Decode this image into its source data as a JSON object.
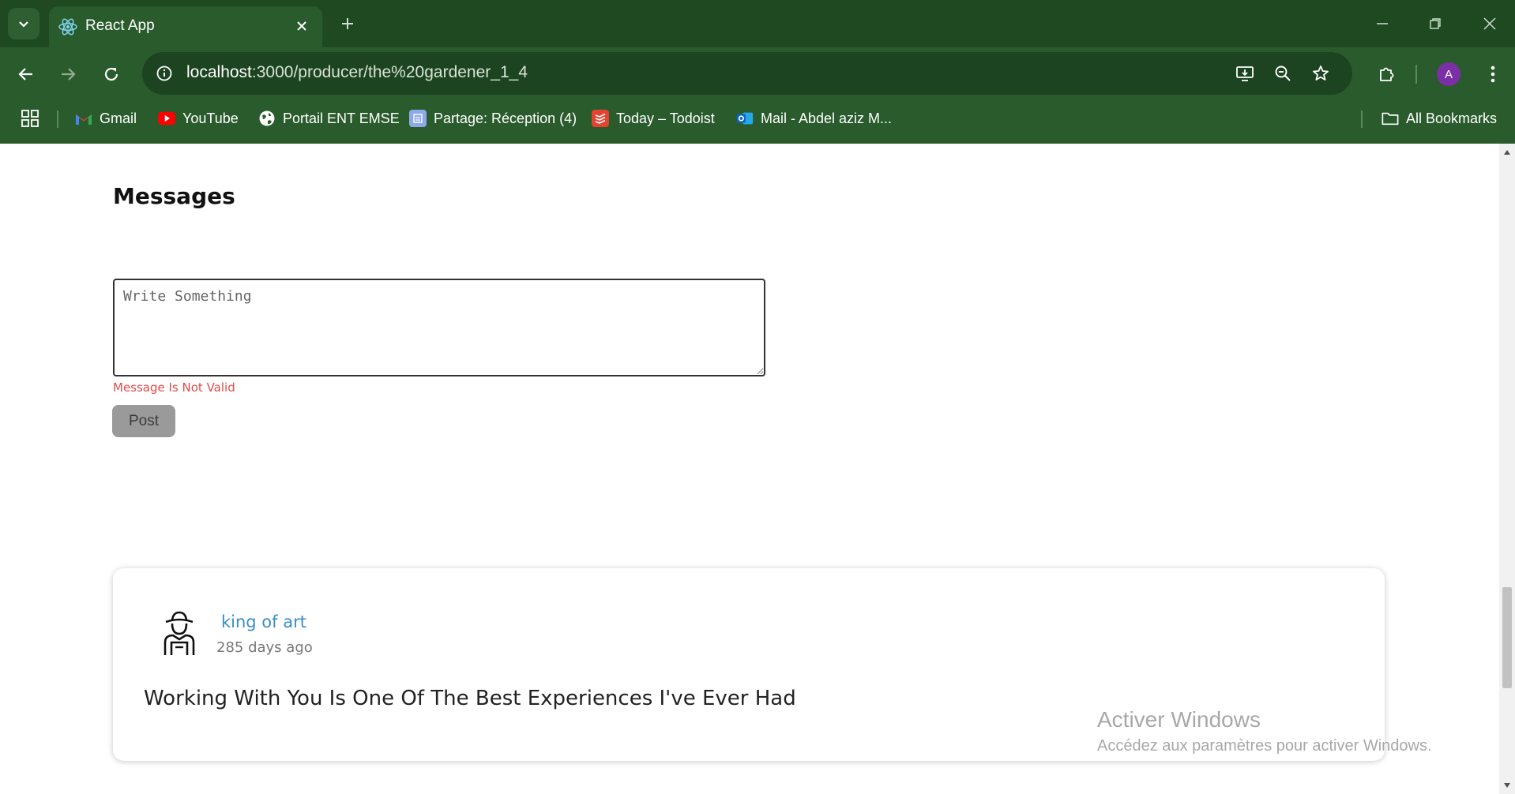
{
  "browser": {
    "tab_title": "React App",
    "url_host": "localhost",
    "url_rest": ":3000/producer/the%20gardener_1_4",
    "profile_initial": "A",
    "icons": {
      "tab_search": "chevron-down-icon",
      "tab_favicon": "react-icon",
      "tab_close": "close-icon",
      "new_tab": "plus-icon",
      "back": "arrow-left-icon",
      "forward": "arrow-right-icon",
      "reload": "reload-icon",
      "site_info": "info-icon",
      "install": "install-app-icon",
      "zoom": "zoom-out-icon",
      "bookmark": "star-icon",
      "extensions": "puzzle-icon",
      "menu": "kebab-icon"
    },
    "colors": {
      "frame": "#1f4a21",
      "toolbar": "#2a5b2c",
      "omnibox": "#1d4420",
      "avatar": "#7b2fa6"
    }
  },
  "bookmarks": {
    "items": [
      {
        "label": "Gmail",
        "icon": "gmail-icon"
      },
      {
        "label": "YouTube",
        "icon": "youtube-icon"
      },
      {
        "label": "Portail ENT EMSE",
        "icon": "globe-icon"
      },
      {
        "label": "Partage: Réception (4)",
        "icon": "partage-icon"
      },
      {
        "label": "Today – Todoist",
        "icon": "todoist-icon"
      },
      {
        "label": "Mail - Abdel aziz M...",
        "icon": "outlook-icon"
      }
    ],
    "all_label": "All Bookmarks"
  },
  "messages": {
    "heading": "Messages",
    "placeholder": "Write Something",
    "error": "Message Is Not Valid",
    "post_label": "Post",
    "error_color": "#e04a4a"
  },
  "comment": {
    "author": "king of art",
    "time": "285 days ago",
    "text": "Working With You Is One Of The Best Experiences I've Ever Had",
    "author_color": "#3a8fc9"
  },
  "watermark": {
    "title": "Activer Windows",
    "subtitle": "Accédez aux paramètres pour activer Windows."
  }
}
